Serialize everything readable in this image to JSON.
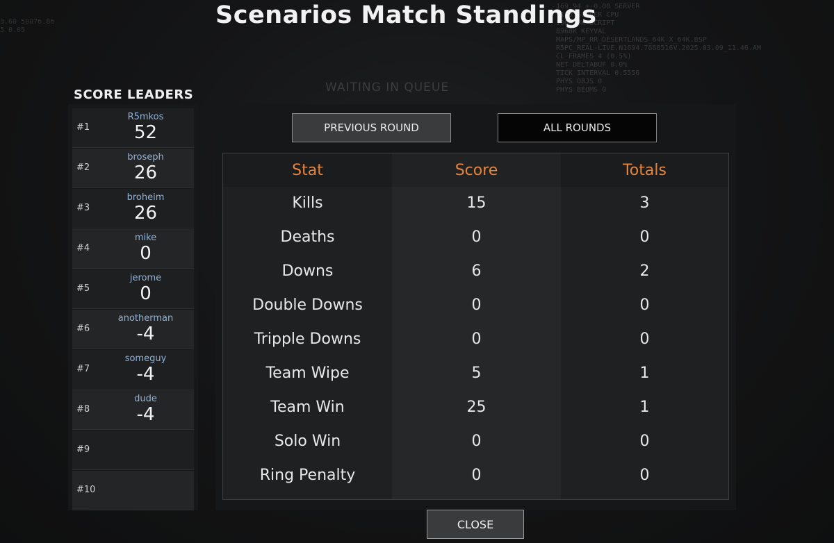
{
  "title": "Scenarios Match Standings",
  "leaders": {
    "title": "SCORE LEADERS",
    "rows": [
      {
        "rank": "#1",
        "name": "R5mkos",
        "score": "52"
      },
      {
        "rank": "#2",
        "name": "broseph",
        "score": "26"
      },
      {
        "rank": "#3",
        "name": "broheim",
        "score": "26"
      },
      {
        "rank": "#4",
        "name": "mike",
        "score": "0"
      },
      {
        "rank": "#5",
        "name": "jerome",
        "score": "0"
      },
      {
        "rank": "#6",
        "name": "anotherman",
        "score": "-4"
      },
      {
        "rank": "#7",
        "name": "someguy",
        "score": "-4"
      },
      {
        "rank": "#8",
        "name": "dude",
        "score": "-4"
      },
      {
        "rank": "#9",
        "name": "",
        "score": ""
      },
      {
        "rank": "#10",
        "name": "",
        "score": ""
      }
    ]
  },
  "tabs": {
    "previous": "PREVIOUS ROUND",
    "all": "ALL ROUNDS"
  },
  "stats": {
    "headers": {
      "stat": "Stat",
      "score": "Score",
      "totals": "Totals"
    },
    "rows": [
      {
        "stat": "Kills",
        "score": "15",
        "total": "3"
      },
      {
        "stat": "Deaths",
        "score": "0",
        "total": "0"
      },
      {
        "stat": "Downs",
        "score": "6",
        "total": "2"
      },
      {
        "stat": "Double Downs",
        "score": "0",
        "total": "0"
      },
      {
        "stat": "Tripple Downs",
        "score": "0",
        "total": "0"
      },
      {
        "stat": "Team Wipe",
        "score": "5",
        "total": "1"
      },
      {
        "stat": "Team Win",
        "score": "25",
        "total": "1"
      },
      {
        "stat": "Solo Win",
        "score": "0",
        "total": "0"
      },
      {
        "stat": "Ring Penalty",
        "score": "0",
        "total": "0"
      }
    ]
  },
  "close_label": "CLOSE",
  "background": {
    "waiting": "WAITING IN QUEUE",
    "corner": "3.60 50076.86\n5 0.05",
    "debug": "169.94 +-0.00 SERVER\n.115 SERVER CPU\n186823K SCRIPT\n8968K KEYVAL\nMAPS/MP_RR_DESERTLANDS_64K_X_64K.BSP\nR5PC_REAL-LIVE.N1694.7668516V.2025.03.09_11.46.AM\nCL FRAMES 4 (0.5%)\nNET DELTABUF 0.0%\nTICK INTERVAL 0.5556\nPHYS OBJS 0\nPHYS BEOMS 0"
  },
  "colors": {
    "header_accent": "#e8843a",
    "player_name": "#8fb3d9"
  }
}
